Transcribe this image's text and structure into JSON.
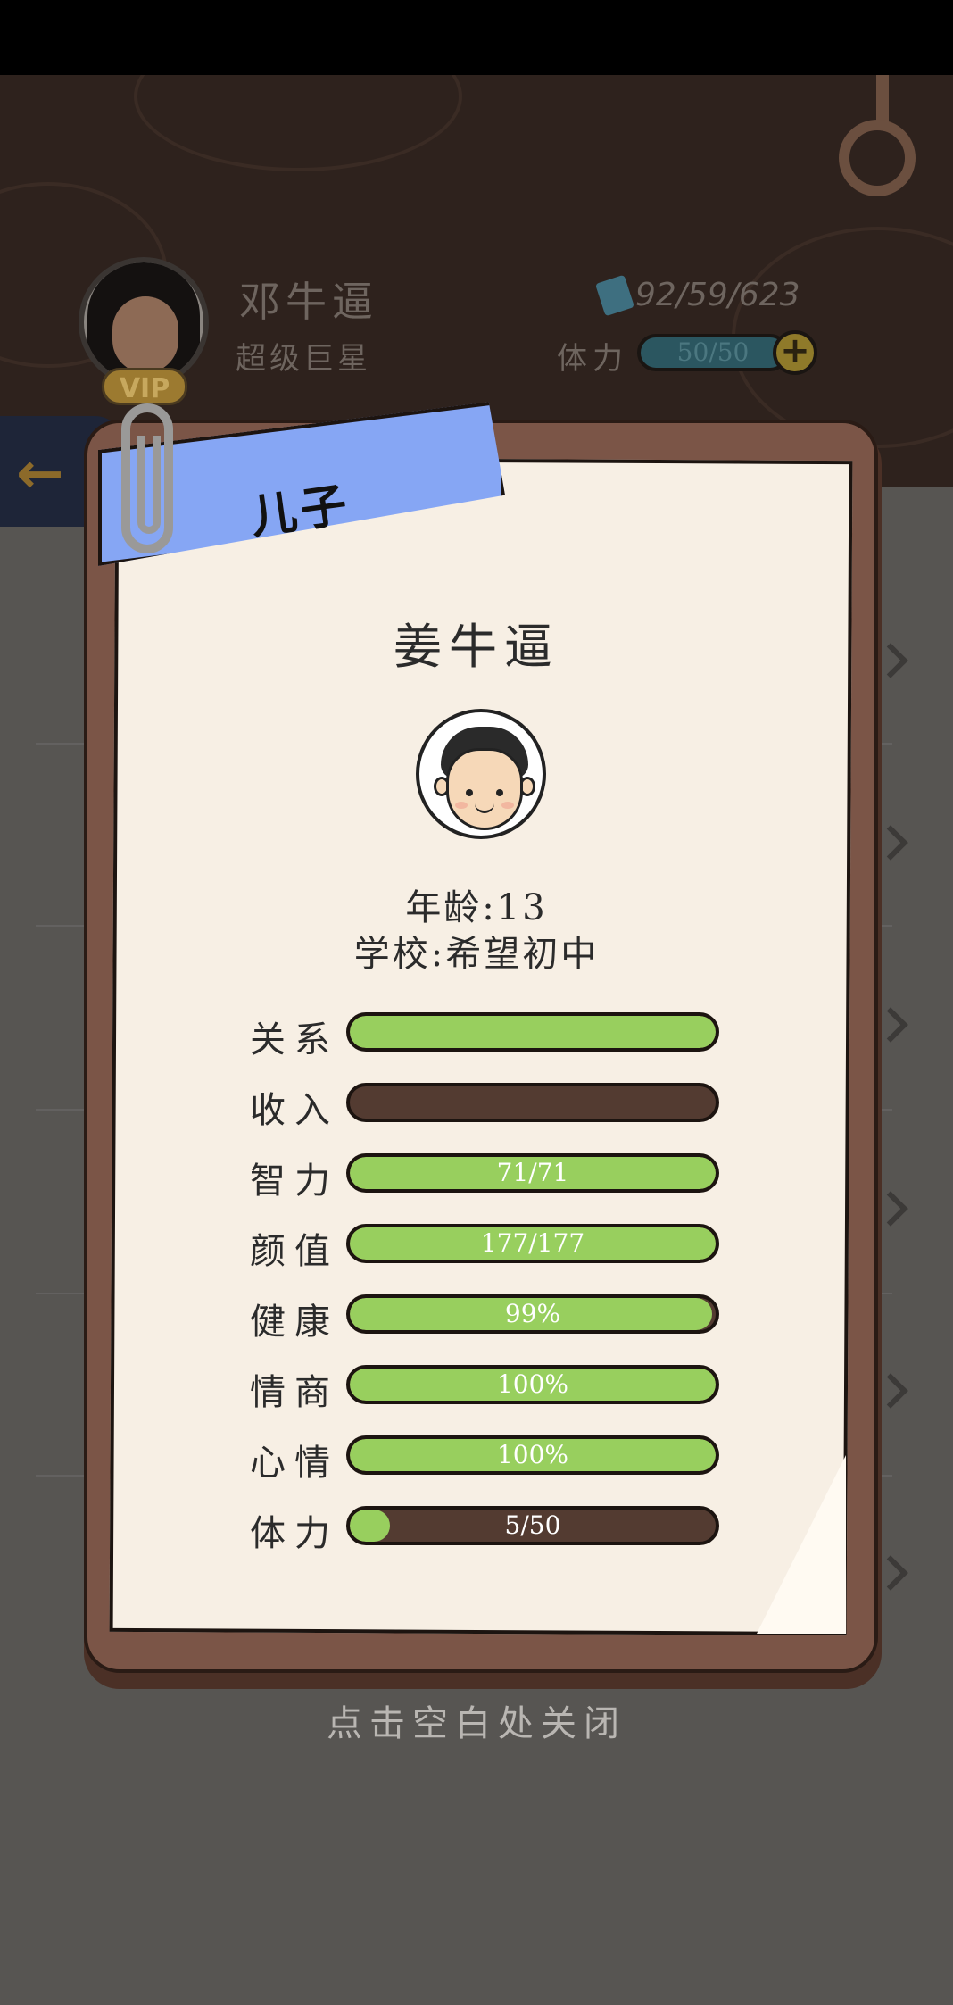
{
  "player": {
    "name": "邓牛逼",
    "title": "超级巨星",
    "vip_badge": "VIP",
    "money": "92/59/623",
    "stamina_label": "体力",
    "stamina_value": "50/50",
    "add_label": "+"
  },
  "modal": {
    "ribbon_label": "儿子",
    "child_name": "姜牛逼",
    "age_line": "年龄:13",
    "school_line": "学校:希望初中",
    "stats": [
      {
        "label": "关系",
        "text": "",
        "fill": 1.0
      },
      {
        "label": "收入",
        "text": "",
        "fill": 0.0
      },
      {
        "label": "智力",
        "text": "71/71",
        "fill": 1.0
      },
      {
        "label": "颜值",
        "text": "177/177",
        "fill": 1.0
      },
      {
        "label": "健康",
        "text": "99%",
        "fill": 0.99
      },
      {
        "label": "情商",
        "text": "100%",
        "fill": 1.0
      },
      {
        "label": "心情",
        "text": "100%",
        "fill": 1.0
      },
      {
        "label": "体力",
        "text": "5/50",
        "fill": 0.1
      }
    ]
  },
  "close_hint": "点击空白处关闭",
  "colors": {
    "bar_fill": "#98cf5e",
    "bar_empty": "#533b31",
    "ribbon": "#86a6f4",
    "card": "#7b5547"
  }
}
